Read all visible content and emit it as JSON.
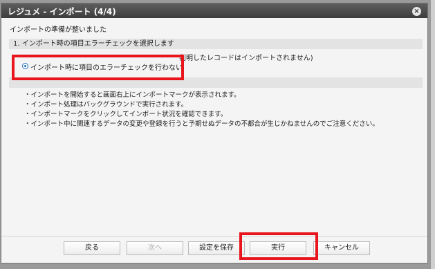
{
  "dialog": {
    "title": "レジュメ - インポート (4/4)",
    "close_glyph": "×",
    "ready_text": "インポートの準備が整いました"
  },
  "section1": {
    "header": "1. インポート時の項目エラーチェックを選択します",
    "option_a_partial": "判明したレコードはインポートされません)",
    "option_b": "インポート時に項目のエラーチェックを行わない"
  },
  "section2": {
    "notes": [
      "・インポートを開始すると画面右上にインポートマークが表示されます。",
      "・インポート処理はバックグラウンドで実行されます。",
      "・インポートマークをクリックしてインポート状況を確認できます。",
      "・インポート中に関連するデータの変更や登録を行うと予期せぬデータの不都合が生じかねませんのでご注意ください。"
    ]
  },
  "buttons": {
    "back": "戻る",
    "next": "次へ",
    "save_settings": "設定を保存",
    "execute": "実行",
    "cancel": "キャンセル"
  },
  "colors": {
    "highlight": "#e8161c",
    "titlebar": "#4a4a4a",
    "radio_selected": "#1f6fbf"
  }
}
